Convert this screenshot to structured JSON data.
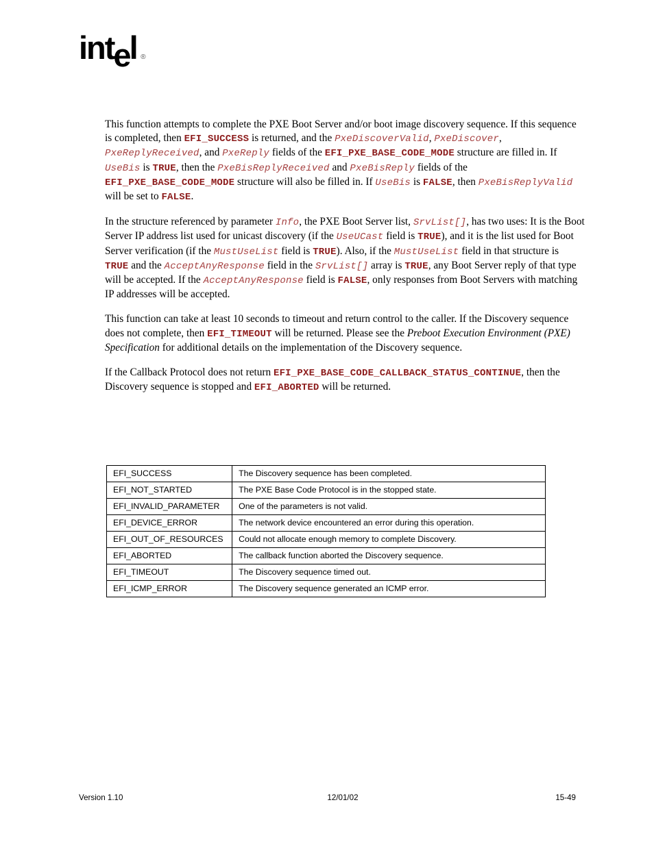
{
  "header": {
    "logo_part_1": "int",
    "logo_part_2": "e",
    "logo_part_3": "l",
    "logo_registered_mark": "®",
    "logo_alt": "Intel"
  },
  "body": {
    "paragraph_1": {
      "segment_01": "This function attempts to complete the PXE Boot Server and/or boot image discovery sequence.  If this sequence is completed, then ",
      "code_01": "EFI_SUCCESS",
      "segment_02": " is returned, and the ",
      "code_02": "PxeDiscoverValid",
      "segment_03": ", ",
      "code_03": "PxeDiscover",
      "segment_04": ", ",
      "code_04": "PxeReplyReceived",
      "segment_05": ", and ",
      "code_05": "PxeReply",
      "segment_06": " fields of the ",
      "code_06": "EFI_PXE_BASE_CODE_MODE",
      "segment_07": " structure are filled in.  If ",
      "code_07": "UseBis",
      "segment_08": " is ",
      "code_08": "TRUE",
      "segment_09": ", then the ",
      "code_09": "PxeBisReplyReceived",
      "segment_10": " and ",
      "code_10": "PxeBisReply",
      "segment_11": " fields of the ",
      "code_11": "EFI_PXE_BASE_CODE_MODE",
      "segment_12": " structure will also be filled in.  If ",
      "code_12": "UseBis",
      "segment_13": " is ",
      "code_13": "FALSE",
      "segment_14": ", then ",
      "code_14": "PxeBisReplyValid",
      "segment_15": " will be set to ",
      "code_15": "FALSE",
      "segment_16": "."
    },
    "paragraph_2": {
      "segment_01": "In the structure referenced by parameter ",
      "code_01": "Info",
      "segment_02": ", the PXE Boot Server list, ",
      "code_02": "SrvList[]",
      "segment_03": ", has two uses:  It is the Boot Server IP address list used for unicast discovery (if the ",
      "code_03": "UseUCast",
      "segment_04": " field is ",
      "code_04": "TRUE",
      "segment_05": "), and it is the list used for Boot Server verification (if the ",
      "code_05": "MustUseList",
      "segment_06": " field is ",
      "code_06": "TRUE",
      "segment_07": ").  Also, if the ",
      "code_07": "MustUseList",
      "segment_08": " field in that structure is ",
      "code_08": "TRUE",
      "segment_09": " and the ",
      "code_09": "AcceptAnyResponse",
      "segment_10": " field in the ",
      "code_10": "SrvList[]",
      "segment_11": " array is ",
      "code_11": "TRUE",
      "segment_12": ", any Boot Server reply of that type will be accepted.  If the ",
      "code_12": "AcceptAnyResponse",
      "segment_13": " field is ",
      "code_13": "FALSE",
      "segment_14": ", only responses from Boot Servers with matching IP addresses will be accepted."
    },
    "paragraph_3": {
      "segment_01": "This function can take at least 10 seconds to timeout and return control to the caller.  If the Discovery sequence does not complete, then ",
      "code_01": "EFI_TIMEOUT",
      "segment_02": " will be returned.  Please see the ",
      "title_01": "Preboot Execution Environment (PXE) Specification",
      "segment_03": " for additional details on the implementation of the Discovery sequence."
    },
    "paragraph_4": {
      "segment_01": "If the Callback Protocol does not return ",
      "code_01": "EFI_PXE_BASE_CODE_CALLBACK_STATUS_CONTINUE",
      "segment_02": ", then the Discovery sequence is stopped and ",
      "code_02": "EFI_ABORTED",
      "segment_03": " will be returned."
    }
  },
  "status_table": {
    "rows": [
      {
        "code": "EFI_SUCCESS",
        "description": "The Discovery sequence has been completed."
      },
      {
        "code": "EFI_NOT_STARTED",
        "description": "The PXE Base Code Protocol is in the stopped state."
      },
      {
        "code": "EFI_INVALID_PARAMETER",
        "description": "One of the parameters is not valid."
      },
      {
        "code": "EFI_DEVICE_ERROR",
        "description": "The network device encountered an error during this operation."
      },
      {
        "code": "EFI_OUT_OF_RESOURCES",
        "description": "Could not allocate enough memory to complete Discovery."
      },
      {
        "code": "EFI_ABORTED",
        "description": "The callback function aborted the Discovery sequence."
      },
      {
        "code": "EFI_TIMEOUT",
        "description": "The Discovery sequence timed out."
      },
      {
        "code": "EFI_ICMP_ERROR",
        "description": "The Discovery sequence generated an ICMP error."
      }
    ]
  },
  "footer": {
    "version": "Version 1.10",
    "date": "12/01/02",
    "page_number": "15-49"
  },
  "colors": {
    "code_bold": "#8c1b1b",
    "code_italic": "#a54040",
    "text": "#000000",
    "table_border": "#000000",
    "background": "#ffffff"
  }
}
